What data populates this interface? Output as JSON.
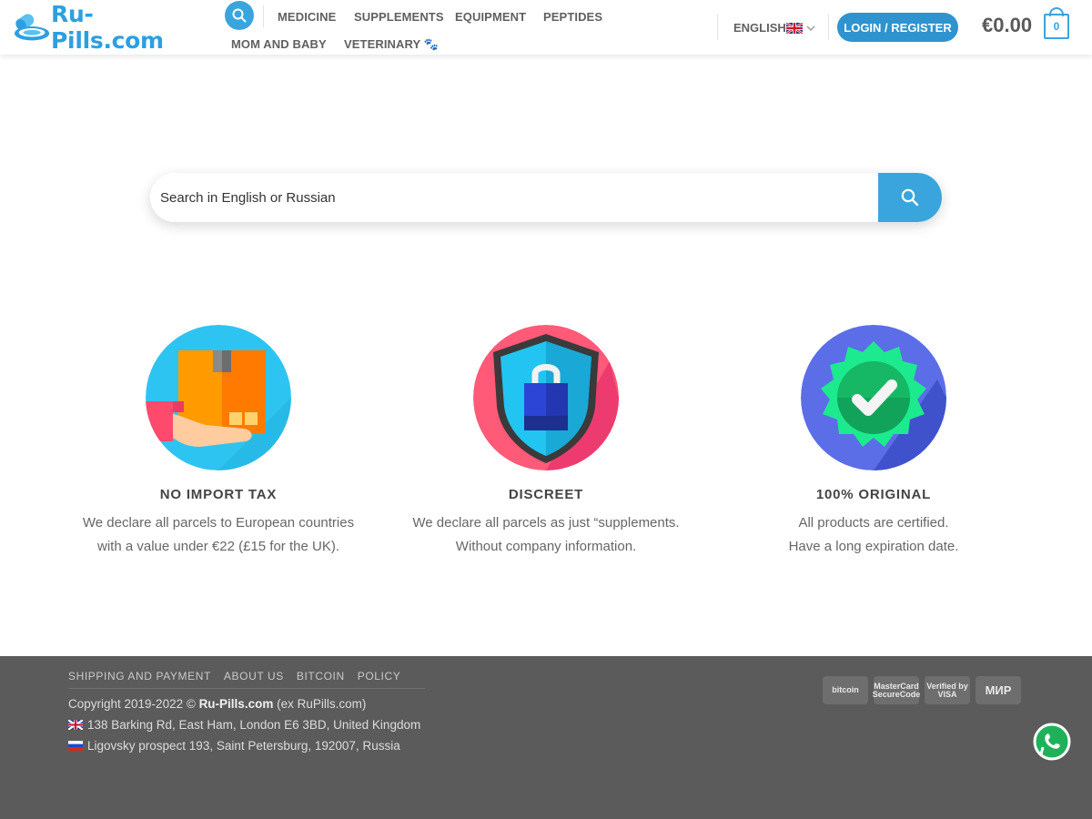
{
  "brand": {
    "name": "Ru-Pills.com",
    "color": "#2d9fe0"
  },
  "header": {
    "nav": [
      "MEDICINE",
      "SUPPLEMENTS",
      "EQUIPMENT",
      "PEPTIDES",
      "MOM AND BABY",
      "VETERINARY 🐾"
    ],
    "language": "ENGLISH",
    "login_label": "LOGIN / REGISTER",
    "cart_total": "€0.00",
    "cart_count": "0"
  },
  "search": {
    "placeholder": "Search in English or Russian"
  },
  "features": [
    {
      "icon": "box-in-hand-icon",
      "title": "NO IMPORT TAX",
      "line1": "We declare all parcels to European countries",
      "line2": "with a value under €22 (£15 for the UK)."
    },
    {
      "icon": "shield-lock-icon",
      "title": "DISCREET",
      "line1": "We declare all parcels as just “supplements.",
      "line2": "Without company information."
    },
    {
      "icon": "certified-badge-icon",
      "title": "100% ORIGINAL",
      "line1": "All products are certified.",
      "line2": "Have a long expiration date."
    }
  ],
  "footer": {
    "links": [
      "SHIPPING AND PAYMENT",
      "ABOUT US",
      "BITCOIN",
      "POLICY"
    ],
    "copyright_prefix": "Copyright 2019-2022 ©",
    "copyright_brand": "Ru-Pills.com",
    "copyright_suffix": "(ex RuPills.com)",
    "address_uk": "138 Barking Rd, East Ham, London E6 3BD, United Kingdom",
    "address_ru": "Ligovsky prospect 193, Saint Petersburg, 192007, Russia",
    "payments": [
      "bitcoin",
      "MasterCard SecureCode",
      "Verified by VISA",
      "МИР"
    ]
  },
  "colors": {
    "accent": "#3aa5dc",
    "login": "#2f93cf",
    "footer_bg": "#5b5b5b"
  }
}
